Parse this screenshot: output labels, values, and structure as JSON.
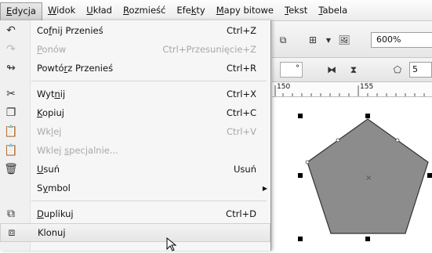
{
  "menubar": [
    {
      "pre": "",
      "m": "E",
      "post": "dycja",
      "active": true
    },
    {
      "pre": "",
      "m": "W",
      "post": "idok"
    },
    {
      "pre": "",
      "m": "U",
      "post": "kład"
    },
    {
      "pre": "",
      "m": "R",
      "post": "ozmieść"
    },
    {
      "pre": "Efe",
      "m": "k",
      "post": "ty"
    },
    {
      "pre": "",
      "m": "M",
      "post": "apy bitowe"
    },
    {
      "pre": "",
      "m": "T",
      "post": "ekst"
    },
    {
      "pre": "",
      "m": "T",
      "post": "abela"
    }
  ],
  "menu": [
    {
      "icon": "undo-icon",
      "glyph": "↶",
      "pre": "Co",
      "m": "f",
      "post": "nij Przenieś",
      "shortcut": "Ctrl+Z"
    },
    {
      "icon": "redo-icon",
      "glyph": "↷",
      "pre": "",
      "m": "P",
      "post": "onów",
      "shortcut": "Ctrl+Przesunięcie+Z",
      "disabled": true
    },
    {
      "icon": "repeat-icon",
      "glyph": "↬",
      "pre": "Powtó",
      "m": "r",
      "post": "z Przenieś",
      "shortcut": "Ctrl+R"
    },
    {
      "sep": true
    },
    {
      "icon": "scissors-icon",
      "glyph": "✂",
      "pre": "Wyt",
      "m": "n",
      "post": "ij",
      "shortcut": "Ctrl+X"
    },
    {
      "icon": "copy-icon",
      "glyph": "❐",
      "pre": "",
      "m": "K",
      "post": "opiuj",
      "shortcut": "Ctrl+C"
    },
    {
      "icon": "paste-icon",
      "glyph": "📋",
      "pre": "Wk",
      "m": "l",
      "post": "ej",
      "shortcut": "Ctrl+V",
      "disabled": true
    },
    {
      "icon": "paste-special-icon",
      "glyph": "📋",
      "pre": "Wklej ",
      "m": "s",
      "post": "pecjalnie...",
      "shortcut": "",
      "disabled": true
    },
    {
      "icon": "trash-icon",
      "glyph": "🗑",
      "pre": "",
      "m": "U",
      "post": "suń",
      "shortcut": "Usuń"
    },
    {
      "icon": "",
      "glyph": "",
      "pre": "S",
      "m": "y",
      "post": "mbol",
      "shortcut": "",
      "submenu": true
    },
    {
      "sep": true
    },
    {
      "icon": "duplicate-icon",
      "glyph": "⧉",
      "pre": "",
      "m": "D",
      "post": "uplikuj",
      "shortcut": "Ctrl+D"
    },
    {
      "icon": "clone-icon",
      "glyph": "⧈",
      "pre": "Klonuj",
      "m": "",
      "post": "",
      "shortcut": "",
      "hover": true
    }
  ],
  "toolbar": {
    "zoom": "600%",
    "angle": "°",
    "sides": "5"
  },
  "ruler": {
    "left": "150",
    "right": "155"
  },
  "colors": {
    "shape_fill": "#8c8c8c",
    "shape_stroke": "#333333"
  }
}
